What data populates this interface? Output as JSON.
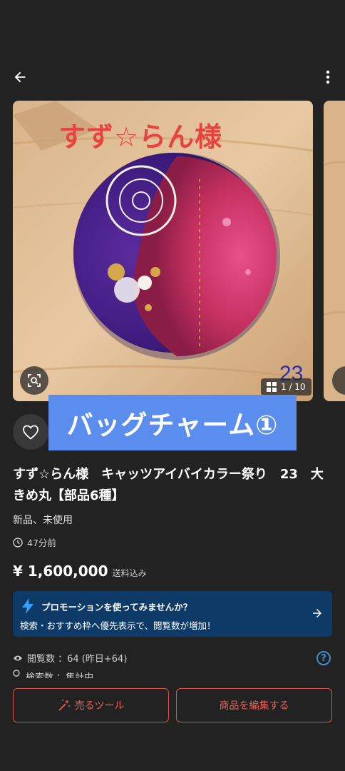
{
  "header": {
    "back_icon": "arrow-left-icon",
    "more_icon": "kebab-menu-icon"
  },
  "gallery": {
    "photo_caption": "すず☆らん様",
    "photo_number": "23",
    "counter": "1 / 10",
    "banner_text": "バッグチャーム①"
  },
  "item": {
    "title": "すず☆らん様　キャッツアイバイカラー祭り　23　大きめ丸【部品6種】",
    "condition": "新品、未使用",
    "time_ago": "47分前",
    "price": "¥ 1,600,000",
    "price_note": "送料込み"
  },
  "promo": {
    "title": "プロモーションを使ってみませんか？",
    "text": "検索・おすすめ枠へ優先表示で、閲覧数が増加！",
    "accent": "#0d3a66"
  },
  "stats": {
    "views": "閲覧数 ：64 (昨日+64)",
    "search": "検索数 ：集計中",
    "help": "?"
  },
  "actions": {
    "sell_tools": "売るツール",
    "edit_item": "商品を編集する",
    "accent": "#d9534a"
  }
}
